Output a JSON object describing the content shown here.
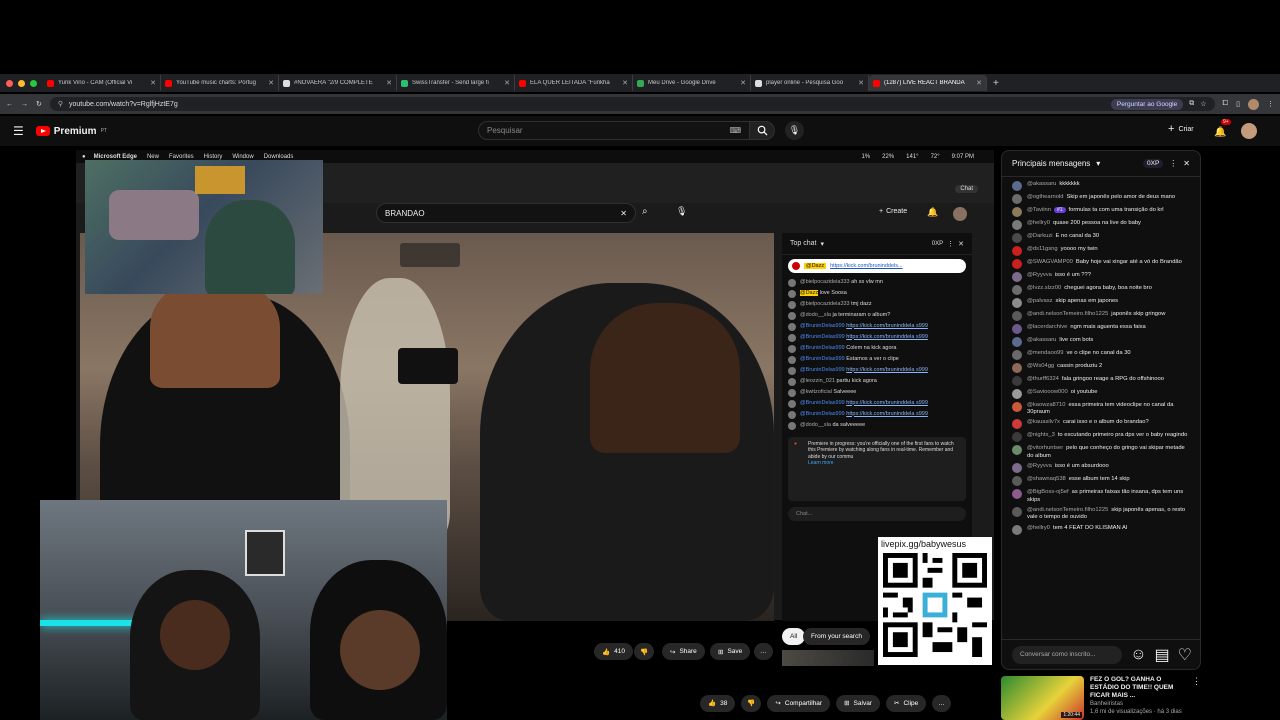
{
  "browser": {
    "tabs": [
      {
        "label": "Yunk Vino - CAM (Official Vi",
        "color": "#ff0000"
      },
      {
        "label": "YouTube music charts: Portug",
        "color": "#ff0000"
      },
      {
        "label": "#NOVAERA \"2/9 COMPLETE",
        "color": "#dddddd"
      },
      {
        "label": "SwissTransfer - Send large fi",
        "color": "#2dbf70"
      },
      {
        "label": "ELA QUER LEITADA \"Funkha",
        "color": "#ff0000"
      },
      {
        "label": "Meu Drive - Google Drive",
        "color": "#34a853"
      },
      {
        "label": "player online - Pesquisa Goo",
        "color": "#dddddd"
      },
      {
        "label": "(1287) LIVE REACT BRANDA",
        "color": "#ff0000"
      }
    ],
    "url": "youtube.com/watch?v=RglfjHztE7g",
    "ask_google": "Perguntar ao Google"
  },
  "youtube": {
    "brand": "Premium",
    "brand_sup": "PT",
    "search_placeholder": "Pesquisar",
    "create_label": "Criar",
    "notif_badge": "9+"
  },
  "mac_menu": {
    "items": [
      "Microsoft Edge",
      "New",
      "Favorites",
      "History",
      "Window",
      "Downloads"
    ],
    "status": [
      "1%",
      "22%",
      "141°",
      "72°",
      "9:07 PM"
    ]
  },
  "inner_youtube": {
    "search_value": "BRANDAO",
    "create_label": "Create",
    "chat_btn": "Chat",
    "likes": "410",
    "share": "Share",
    "save": "Save",
    "filter_all": "All",
    "filter_search": "From your search"
  },
  "inner_chat": {
    "title": "Top chat",
    "xp": "0XP",
    "pinned_user": "@Dazz",
    "pinned_link": "https://kick.com/bruninddels...",
    "messages": [
      {
        "user": "@bielpocazideia333",
        "text": "ah ss vlw mn",
        "link": false
      },
      {
        "user": "@Dazz",
        "text": "love Soosa",
        "link": false
      },
      {
        "user": "@bielpocazideia333",
        "text": "tmj dazz",
        "link": false
      },
      {
        "user": "@dodo__sla",
        "text": "ja terminaram o album?",
        "link": false
      },
      {
        "user": "@BruninDelas999",
        "text": "https://kick.com/bruninddela s999",
        "link": true
      },
      {
        "user": "@BruninDelas999",
        "text": "https://kick.com/bruninddela s999",
        "link": true
      },
      {
        "user": "@BruninDelas999",
        "text": "Colem na kick agora",
        "link": false
      },
      {
        "user": "@BruninDelas999",
        "text": "Estamos a ver o clipe",
        "link": false
      },
      {
        "user": "@BruninDelas999",
        "text": "https://kick.com/bruninddela s999",
        "link": true
      },
      {
        "user": "@leozzin_021",
        "text": "partiu kick agora",
        "link": false
      },
      {
        "user": "@kwitzoficial",
        "text": "Salveeee",
        "link": false
      },
      {
        "user": "@BruninDelas999",
        "text": "https://kick.com/bruninddela s999",
        "link": true
      },
      {
        "user": "@BruninDelas999",
        "text": "https://kick.com/bruninddela s999",
        "link": true
      },
      {
        "user": "@dodo__sla",
        "text": "da salveeeee",
        "link": false
      }
    ],
    "premiere_text": "Premiere in progress: you're officially one of the first fans to watch this Premiere by watching along fans in real-time. Remember and abide by our commu",
    "learn_more": "Learn more",
    "input_placeholder": "Chat..."
  },
  "qr": {
    "label": "livepix.gg/babywesus"
  },
  "live_chat": {
    "title": "Principais mensagens",
    "xp": "0XP",
    "messages": [
      {
        "user": "@akassaru",
        "text": "kkkkkkk",
        "color": "#5a6b8c"
      },
      {
        "user": "@ogthearnold",
        "text": "Skip em japonês pelo amor de deus mano",
        "color": "#6b6b6b"
      },
      {
        "user": "@Taviinn",
        "badge": "#1",
        "text": "formulas ta com uma transição do krl",
        "color": "#8c7a5a"
      },
      {
        "user": "@hellry0",
        "text": "quase 200 pessoa na live do baby",
        "color": "#7a7a7a"
      },
      {
        "user": "@Darkuzi",
        "text": "E no canal da 30",
        "color": "#4a4a4a"
      },
      {
        "user": "@ds11gsng",
        "text": "yoooo my twin",
        "color": "#cc1f1f"
      },
      {
        "user": "@SWAGVAMP00",
        "text": "Baby hoje vai xingar até a vó do Brandão",
        "color": "#cc1f1f"
      },
      {
        "user": "@Ryyvva",
        "text": "isso é um ???",
        "color": "#7d6b8c"
      },
      {
        "user": "@Ivzz.slzz00",
        "text": "cheguei agora baby, boa noite bro",
        "color": "#6c6c6c"
      },
      {
        "user": "@palvasz",
        "text": "skip apenas em japones",
        "color": "#8c8c8c"
      },
      {
        "user": "@andi.nelsonTemeiro.filho1225",
        "text": "japonês skip gringow",
        "color": "#5a5a5a"
      },
      {
        "user": "@lacerdarchive",
        "text": "ngm mais aguenta essa faixa",
        "color": "#6a5a8c"
      },
      {
        "user": "@akassaru",
        "text": "live com bots",
        "color": "#5a6b8c"
      },
      {
        "user": "@mendaoo99",
        "text": "ve o clipe no canal da 30",
        "color": "#6a6a6a"
      },
      {
        "user": "@Ws04gg",
        "text": "cassin produziu 2",
        "color": "#8c6a5a"
      },
      {
        "user": "@thurff6324",
        "text": "fala gringoo reage a RPG do offshinooo",
        "color": "#3a3a3a"
      },
      {
        "user": "@Saviooow000",
        "text": "oi youtube",
        "color": "#9a9a9a"
      },
      {
        "user": "@kaowza8710",
        "text": "essa primeira tem videoclipe no canal da 30praum",
        "color": "#cc5a3a"
      },
      {
        "user": "@kauasilv7x",
        "text": "carai isso e o album do brandao?",
        "color": "#cc3a3a"
      },
      {
        "user": "@nightx_3",
        "text": "to escutando primeiro pra dps ver o baby reagindo",
        "color": "#3a3a3a"
      },
      {
        "user": "@vitorhuntser",
        "text": "pelo que conheço do gringo vai skipar metade do album",
        "color": "#6a8c6a"
      },
      {
        "user": "@Ryyvva",
        "text": "isso é um absurdooo",
        "color": "#7d6b8c"
      },
      {
        "user": "@shawnaq538",
        "text": "esse album tem 14 skip",
        "color": "#5a5a5a"
      },
      {
        "user": "@BigBoss-oj5ef",
        "text": "as primeiras faixas tão insana, dps tem uns skips",
        "color": "#8c5a8c"
      },
      {
        "user": "@andi.nelsonTemeiro.filho1225",
        "text": "skip japonês apenas, o resto vale o tempo de ouvido",
        "color": "#5a5a5a"
      },
      {
        "user": "@hellry0",
        "text": "tem 4 FEAT DO KLISMAN AI",
        "color": "#7a7a7a"
      }
    ],
    "input_placeholder": "Conversar como inscrito..."
  },
  "actions": {
    "likes": "38",
    "share": "Compartilhar",
    "save": "Salvar",
    "clip": "Clipe"
  },
  "recommendation": {
    "title": "FEZ O GOL? GANHA O ESTÁDIO DO TIME!! QUEM FICAR MAIS ...",
    "channel": "Banheiristas",
    "meta": "1,6 mi de visualizações · há 3 dias",
    "duration": "1:20:44"
  }
}
